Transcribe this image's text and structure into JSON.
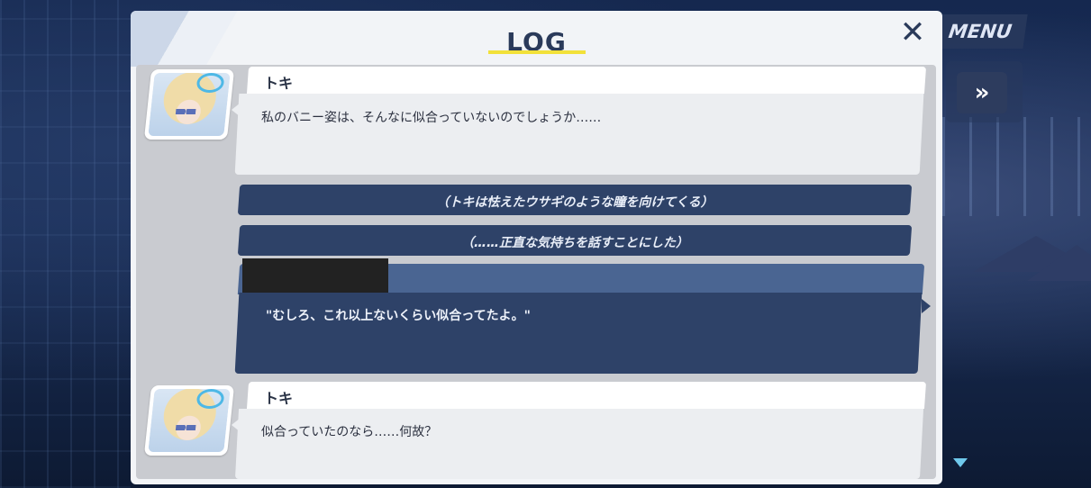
{
  "log_panel": {
    "title": "LOG",
    "close_icon": "close-icon"
  },
  "hud": {
    "menu_label": "MENU",
    "fast_forward_glyph": "»",
    "fast_forward_icon": "fast-forward-icon",
    "close_glyph": "✕"
  },
  "entries": [
    {
      "type": "dialogue",
      "speaker": "トキ",
      "text": "私のバニー姿は、そんなに似合っていないのでしょうか……"
    },
    {
      "type": "narration",
      "text": "（トキは怯えたウサギのような瞳を向けてくる）"
    },
    {
      "type": "narration",
      "text": "（……正直な気持ちを話すことにした）"
    },
    {
      "type": "player",
      "speaker_redacted": true,
      "text": "\"むしろ、これ以上ないくらい似合ってたよ。\""
    },
    {
      "type": "dialogue",
      "speaker": "トキ",
      "text": "似合っていたのなら……何故？"
    }
  ],
  "colors": {
    "title_underline": "#f2e13a",
    "narration_bg": "#2e4268",
    "player_header_bg": "#4a6592",
    "scroll_marker": "#6fc9ec"
  }
}
